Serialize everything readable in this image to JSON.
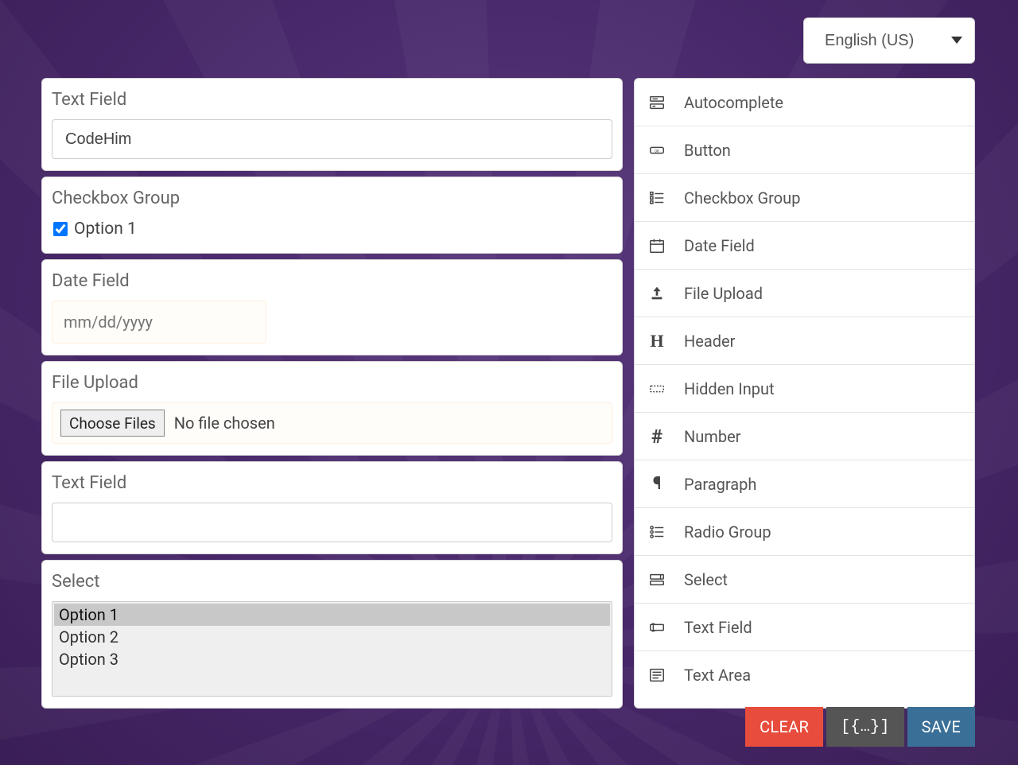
{
  "language": {
    "selected": "English (US)"
  },
  "preview": {
    "text_field_1": {
      "label": "Text Field",
      "value": "CodeHim"
    },
    "checkbox_group": {
      "label": "Checkbox Group",
      "options": [
        {
          "label": "Option 1",
          "checked": true
        }
      ]
    },
    "date_field": {
      "label": "Date Field",
      "placeholder": "mm/dd/yyyy",
      "value": ""
    },
    "file_upload": {
      "label": "File Upload",
      "button_label": "Choose Files",
      "status": "No file chosen"
    },
    "text_field_2": {
      "label": "Text Field",
      "value": ""
    },
    "select": {
      "label": "Select",
      "options": [
        "Option 1",
        "Option 2",
        "Option 3"
      ],
      "selected_index": 0
    }
  },
  "palette": [
    {
      "icon": "autocomplete",
      "label": "Autocomplete"
    },
    {
      "icon": "button",
      "label": "Button"
    },
    {
      "icon": "checkbox",
      "label": "Checkbox Group"
    },
    {
      "icon": "date",
      "label": "Date Field"
    },
    {
      "icon": "upload",
      "label": "File Upload"
    },
    {
      "icon": "header",
      "label": "Header"
    },
    {
      "icon": "hidden",
      "label": "Hidden Input"
    },
    {
      "icon": "number",
      "label": "Number"
    },
    {
      "icon": "paragraph",
      "label": "Paragraph"
    },
    {
      "icon": "radio",
      "label": "Radio Group"
    },
    {
      "icon": "select",
      "label": "Select"
    },
    {
      "icon": "text",
      "label": "Text Field"
    },
    {
      "icon": "textarea",
      "label": "Text Area"
    }
  ],
  "footer": {
    "clear": "CLEAR",
    "data": "[{…}]",
    "save": "SAVE"
  }
}
